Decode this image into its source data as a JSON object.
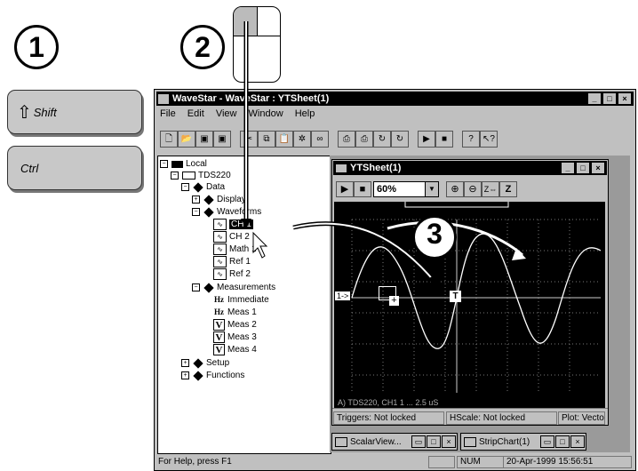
{
  "steps": {
    "one": "1",
    "two": "2",
    "three": "3"
  },
  "keys": {
    "shift": "Shift",
    "ctrl": "Ctrl"
  },
  "window": {
    "title": "WaveStar - WaveStar : YTSheet(1)",
    "menu": [
      "File",
      "Edit",
      "View",
      "Window",
      "Help"
    ],
    "status_help": "For Help, press F1",
    "status_num": "NUM",
    "status_time": "20-Apr-1999 15:56:51"
  },
  "tree": {
    "local": "Local",
    "device": "TDS220",
    "data": "Data",
    "display": "Display",
    "waveforms": "Waveforms",
    "ch1": "CH 1",
    "ch2": "CH 2",
    "math1": "Math 1",
    "ref1": "Ref 1",
    "ref2": "Ref 2",
    "measurements": "Measurements",
    "immediate": "Immediate",
    "meas1": "Meas 1",
    "meas2": "Meas 2",
    "meas3": "Meas 3",
    "meas4": "Meas 4",
    "setup": "Setup",
    "functions": "Functions"
  },
  "ytsheet": {
    "title": "YTSheet(1)",
    "zoom": "60%",
    "channel_marker": "1->",
    "trigger_marker": "T",
    "readout": "A) TDS220, CH1  1 ...  2.5 uS",
    "triggers": "Triggers: Not locked",
    "hscale": "HScale: Not locked",
    "plot": "Plot: Vecto"
  },
  "minimized": {
    "scalar": "ScalarView...",
    "strip": "StripChart(1)"
  },
  "colors": {
    "titlebar": "#000000",
    "face": "#c0c0c0",
    "scope_bg": "#000000",
    "trace": "#ffffff"
  }
}
